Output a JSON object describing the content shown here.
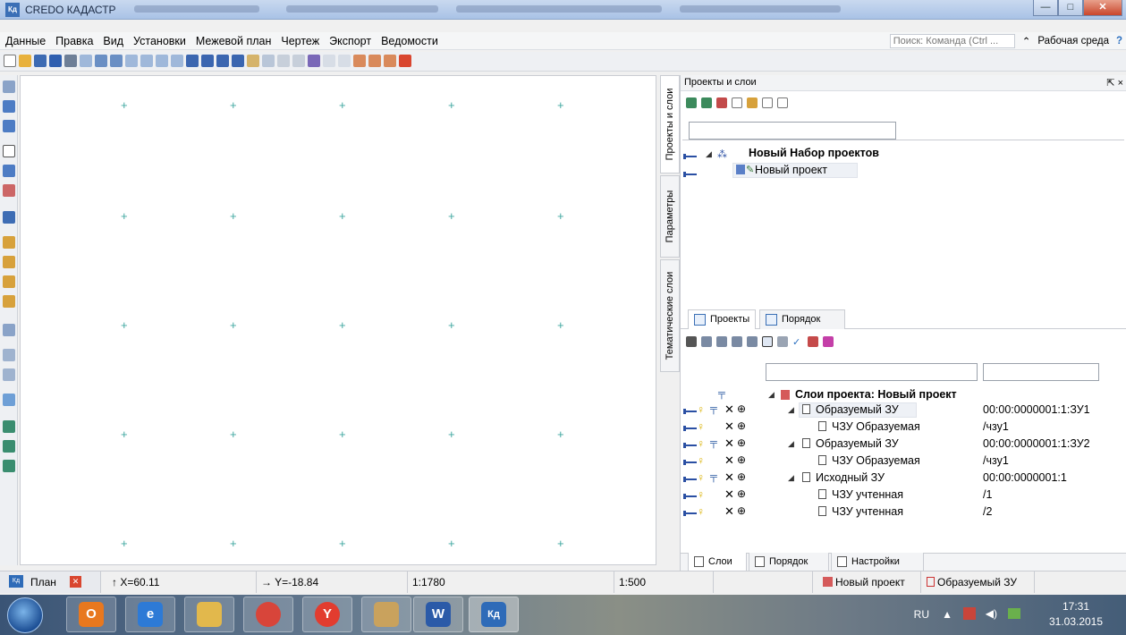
{
  "window": {
    "app_icon_text": "Кд",
    "title": "CREDO КАДАСТР",
    "btn_minimize": "—",
    "btn_maximize": "□",
    "btn_close": "✕"
  },
  "menu": {
    "items": [
      "Данные",
      "Правка",
      "Вид",
      "Установки",
      "Межевой план",
      "Чертеж",
      "Экспорт",
      "Ведомости"
    ],
    "search_placeholder": "Поиск: Команда (Ctrl ...",
    "workspace_label": "Рабочая среда"
  },
  "side_tabs": {
    "projects_layers": "Проекты и слои",
    "parameters": "Параметры",
    "thematic_layers": "Тематические слои"
  },
  "projects_panel": {
    "title": "Проекты и слои",
    "pin_icon": "⇱ ×",
    "tree": {
      "set_label": "Новый Набор проектов",
      "project_label": "Новый проект"
    }
  },
  "mid_tabs": {
    "projects": "Проекты",
    "order": "Порядок"
  },
  "layers": {
    "root_label": "Слои проекта: Новый проект",
    "rows": [
      {
        "name": "Образуемый ЗУ",
        "code": "00:00:0000001:1:ЗУ1"
      },
      {
        "name": "ЧЗУ Образуемая",
        "code": "/чзу1"
      },
      {
        "name": "Образуемый ЗУ",
        "code": "00:00:0000001:1:ЗУ2"
      },
      {
        "name": "ЧЗУ Образуемая",
        "code": "/чзу1"
      },
      {
        "name": "Исходный ЗУ",
        "code": "00:00:0000001:1"
      },
      {
        "name": "ЧЗУ учтенная",
        "code": "/1"
      },
      {
        "name": "ЧЗУ учтенная",
        "code": "/2"
      }
    ]
  },
  "bottom_tabs": {
    "layers": "Слои",
    "order": "Порядок",
    "settings": "Настройки"
  },
  "status": {
    "plan_tab": "План",
    "x_coord": "↑ X=60.11",
    "y_coord": "→ Y=-18.84",
    "scale1": "1:1780",
    "scale2": "1:500",
    "project": "Новый проект",
    "layer": "Образуемый ЗУ"
  },
  "taskbar": {
    "lang": "RU",
    "time": "17:31",
    "date": "31.03.2015"
  },
  "colors": {
    "accent": "#3b6fb6",
    "grid_cross": "#3fa7a0"
  }
}
